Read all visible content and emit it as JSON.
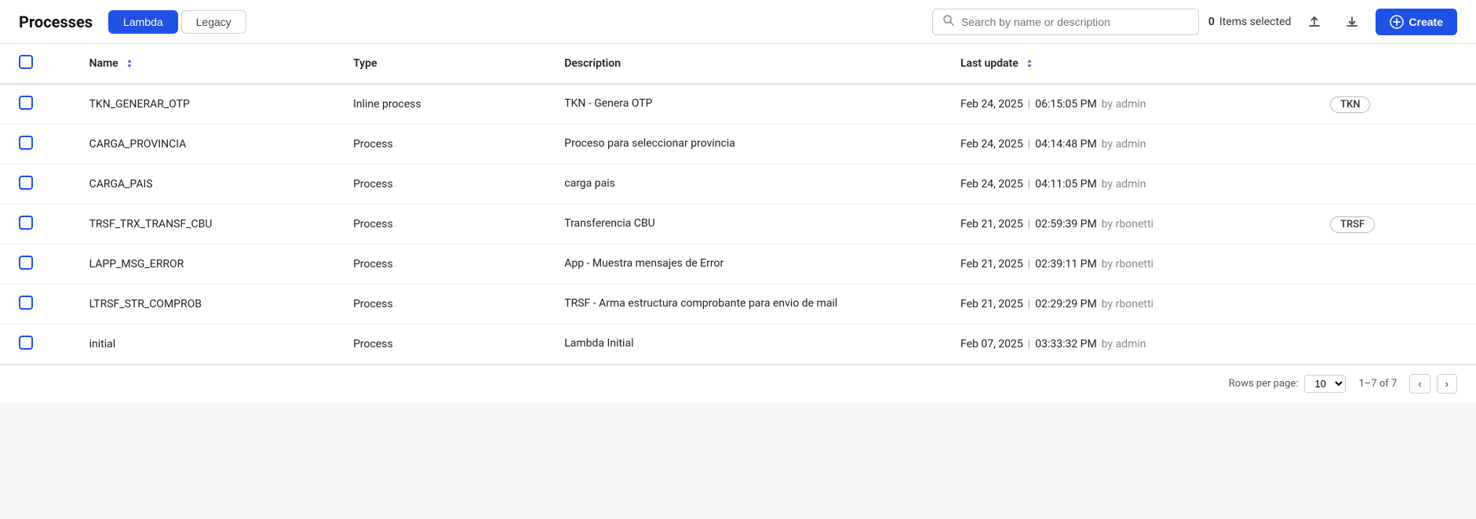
{
  "header": {
    "app_title": "Processes",
    "tabs": [
      {
        "id": "lambda",
        "label": "Lambda",
        "active": true
      },
      {
        "id": "legacy",
        "label": "Legacy",
        "active": false
      }
    ],
    "search": {
      "placeholder": "Search by name or description"
    },
    "items_selected": {
      "count": "0",
      "label": "Items selected"
    },
    "upload_icon": "↑",
    "download_icon": "↓",
    "create_label": "Create"
  },
  "table": {
    "columns": [
      {
        "id": "name",
        "label": "Name",
        "sortable": true
      },
      {
        "id": "type",
        "label": "Type",
        "sortable": false
      },
      {
        "id": "description",
        "label": "Description",
        "sortable": false
      },
      {
        "id": "last_update",
        "label": "Last update",
        "sortable": true
      },
      {
        "id": "tag",
        "label": "",
        "sortable": false
      }
    ],
    "rows": [
      {
        "name": "TKN_GENERAR_OTP",
        "type": "Inline process",
        "description": "TKN - Genera OTP",
        "date": "Feb 24, 2025",
        "time": "06:15:05 PM",
        "by": "by admin",
        "tag": "TKN"
      },
      {
        "name": "CARGA_PROVINCIA",
        "type": "Process",
        "description": "Proceso para seleccionar provincia",
        "date": "Feb 24, 2025",
        "time": "04:14:48 PM",
        "by": "by admin",
        "tag": ""
      },
      {
        "name": "CARGA_PAIS",
        "type": "Process",
        "description": "carga pais",
        "date": "Feb 24, 2025",
        "time": "04:11:05 PM",
        "by": "by admin",
        "tag": ""
      },
      {
        "name": "TRSF_TRX_TRANSF_CBU",
        "type": "Process",
        "description": "Transferencia CBU",
        "date": "Feb 21, 2025",
        "time": "02:59:39 PM",
        "by": "by rbonetti",
        "tag": "TRSF"
      },
      {
        "name": "LAPP_MSG_ERROR",
        "type": "Process",
        "description": "App - Muestra mensajes de Error",
        "date": "Feb 21, 2025",
        "time": "02:39:11 PM",
        "by": "by rbonetti",
        "tag": ""
      },
      {
        "name": "LTRSF_STR_COMPROB",
        "type": "Process",
        "description": "TRSF - Arma estructura comprobante para envio de mail",
        "date": "Feb 21, 2025",
        "time": "02:29:29 PM",
        "by": "by rbonetti",
        "tag": ""
      },
      {
        "name": "initial",
        "type": "Process",
        "description": "Lambda Initial",
        "date": "Feb 07, 2025",
        "time": "03:33:32 PM",
        "by": "by admin",
        "tag": ""
      }
    ]
  },
  "footer": {
    "rows_per_page_label": "Rows per page:",
    "rows_per_page_value": "10",
    "page_info": "1–7 of 7",
    "prev_label": "‹",
    "next_label": "›"
  }
}
